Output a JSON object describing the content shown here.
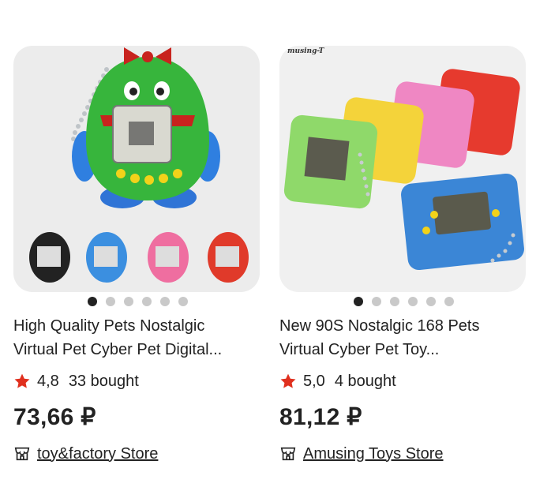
{
  "products": [
    {
      "title_line1": "High Quality Pets Nostalgic",
      "title_line2": "Virtual Pet Cyber Pet Digital...",
      "rating": "4,8",
      "bought": "33 bought",
      "price": "73,66 ₽",
      "store": "toy&factory Store",
      "image_dots": 6,
      "active_dot": 0,
      "image_icon": "green-virtual-pet-image"
    },
    {
      "title_line1": "New 90S Nostalgic 168 Pets",
      "title_line2": "Virtual Cyber Pet Toy...",
      "rating": "5,0",
      "bought": "4 bought",
      "price": "81,12 ₽",
      "store": "Amusing Toys Store",
      "image_dots": 6,
      "active_dot": 0,
      "image_brand_text": "musing-T",
      "image_icon": "square-virtual-pets-image"
    }
  ],
  "colors": {
    "star": "#e0301e",
    "text": "#222222",
    "dot_active": "#222222",
    "dot_inactive": "#c9c9c9"
  }
}
